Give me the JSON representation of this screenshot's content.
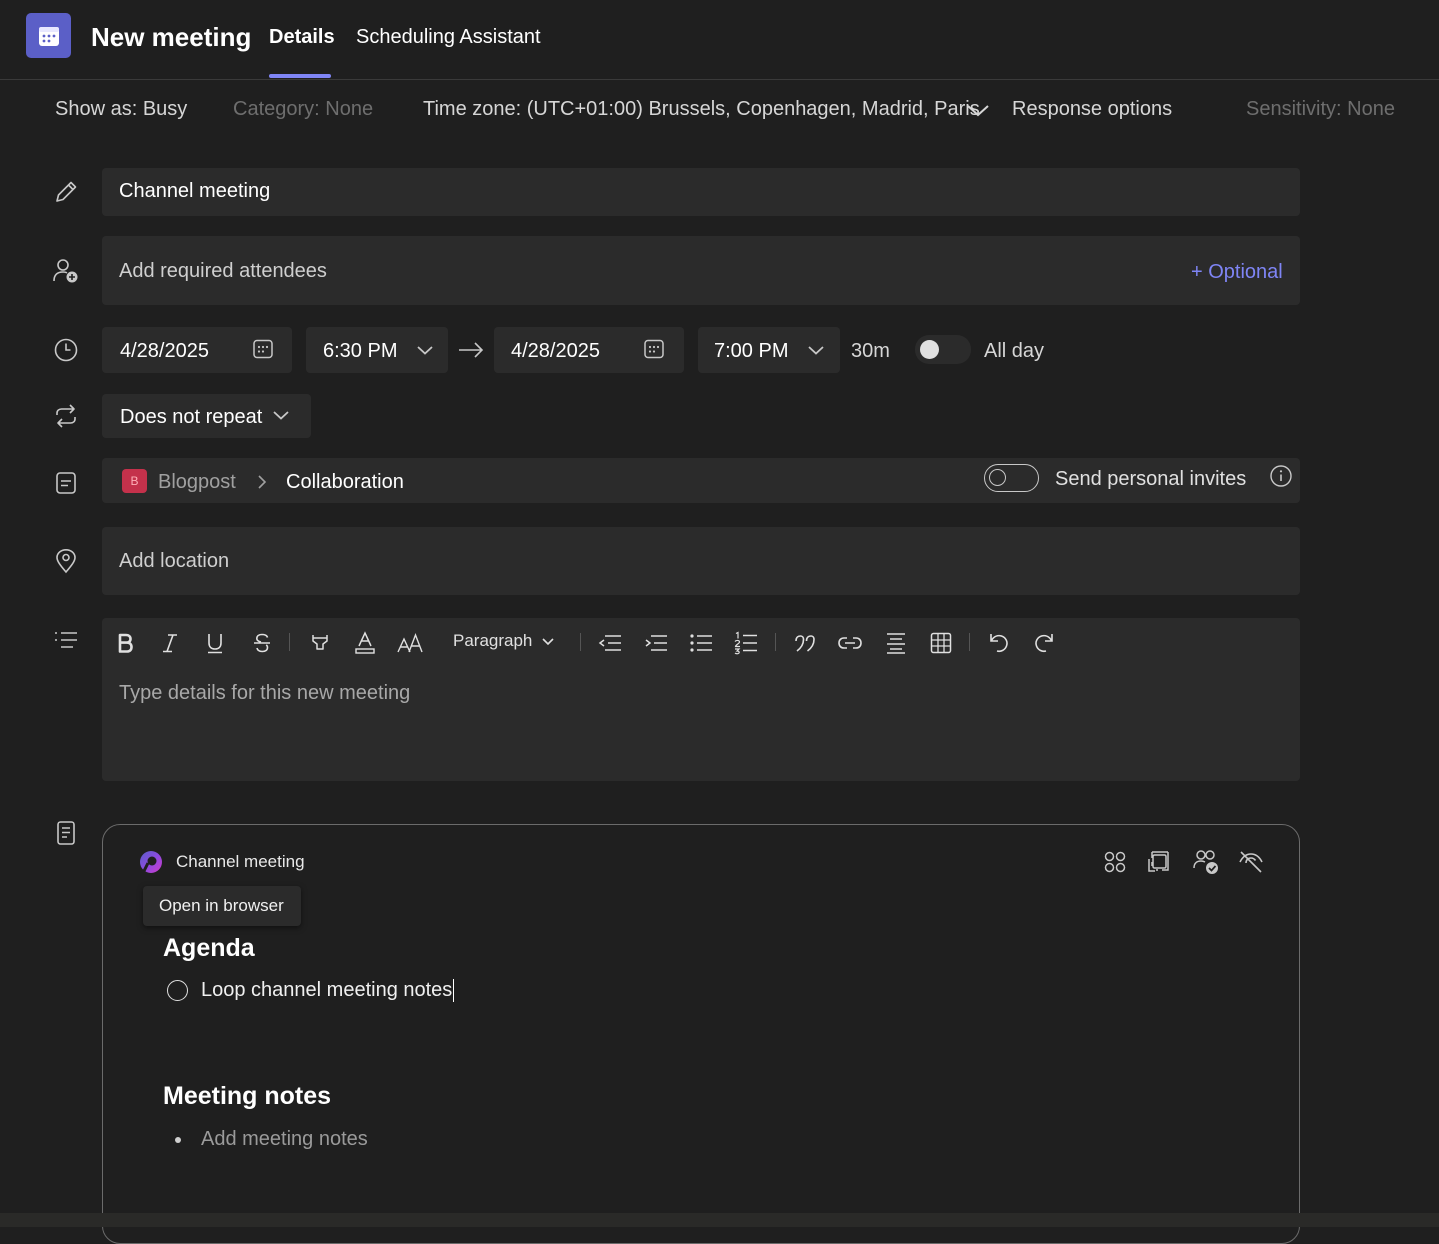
{
  "header": {
    "title": "New meeting",
    "tabs": [
      {
        "label": "Details",
        "active": true
      },
      {
        "label": "Scheduling Assistant",
        "active": false
      }
    ]
  },
  "options": {
    "show_as": "Show as: Busy",
    "category": "Category: None",
    "time_zone": "Time zone: (UTC+01:00) Brussels, Copenhagen, Madrid, Paris",
    "response_options": "Response options",
    "sensitivity": "Sensitivity: None"
  },
  "form": {
    "title_value": "Channel meeting",
    "attendees_placeholder": "Add required attendees",
    "optional_label": "+ Optional",
    "start_date": "4/28/2025",
    "start_time": "6:30 PM",
    "end_date": "4/28/2025",
    "end_time": "7:00 PM",
    "duration": "30m",
    "all_day_label": "All day",
    "all_day_on": false,
    "repeat": "Does not repeat",
    "team_badge": "B",
    "team_name": "Blogpost",
    "channel_name": "Collaboration",
    "send_invites_label": "Send personal invites",
    "send_invites_on": false,
    "location_placeholder": "Add location",
    "details_placeholder": "Type details for this new meeting",
    "paragraph_label": "Paragraph"
  },
  "loop": {
    "title": "Channel meeting",
    "tooltip": "Open in browser",
    "agenda_heading": "Agenda",
    "agenda_item": "Loop channel meeting notes",
    "notes_heading": "Meeting notes",
    "notes_placeholder": "Add meeting notes"
  },
  "colors": {
    "accent": "#7f85f5",
    "app_icon_bg": "#5b5fc7",
    "team_badge_bg": "#c4314b",
    "background": "#1f1f1f",
    "field_bg": "#2b2b2b"
  }
}
